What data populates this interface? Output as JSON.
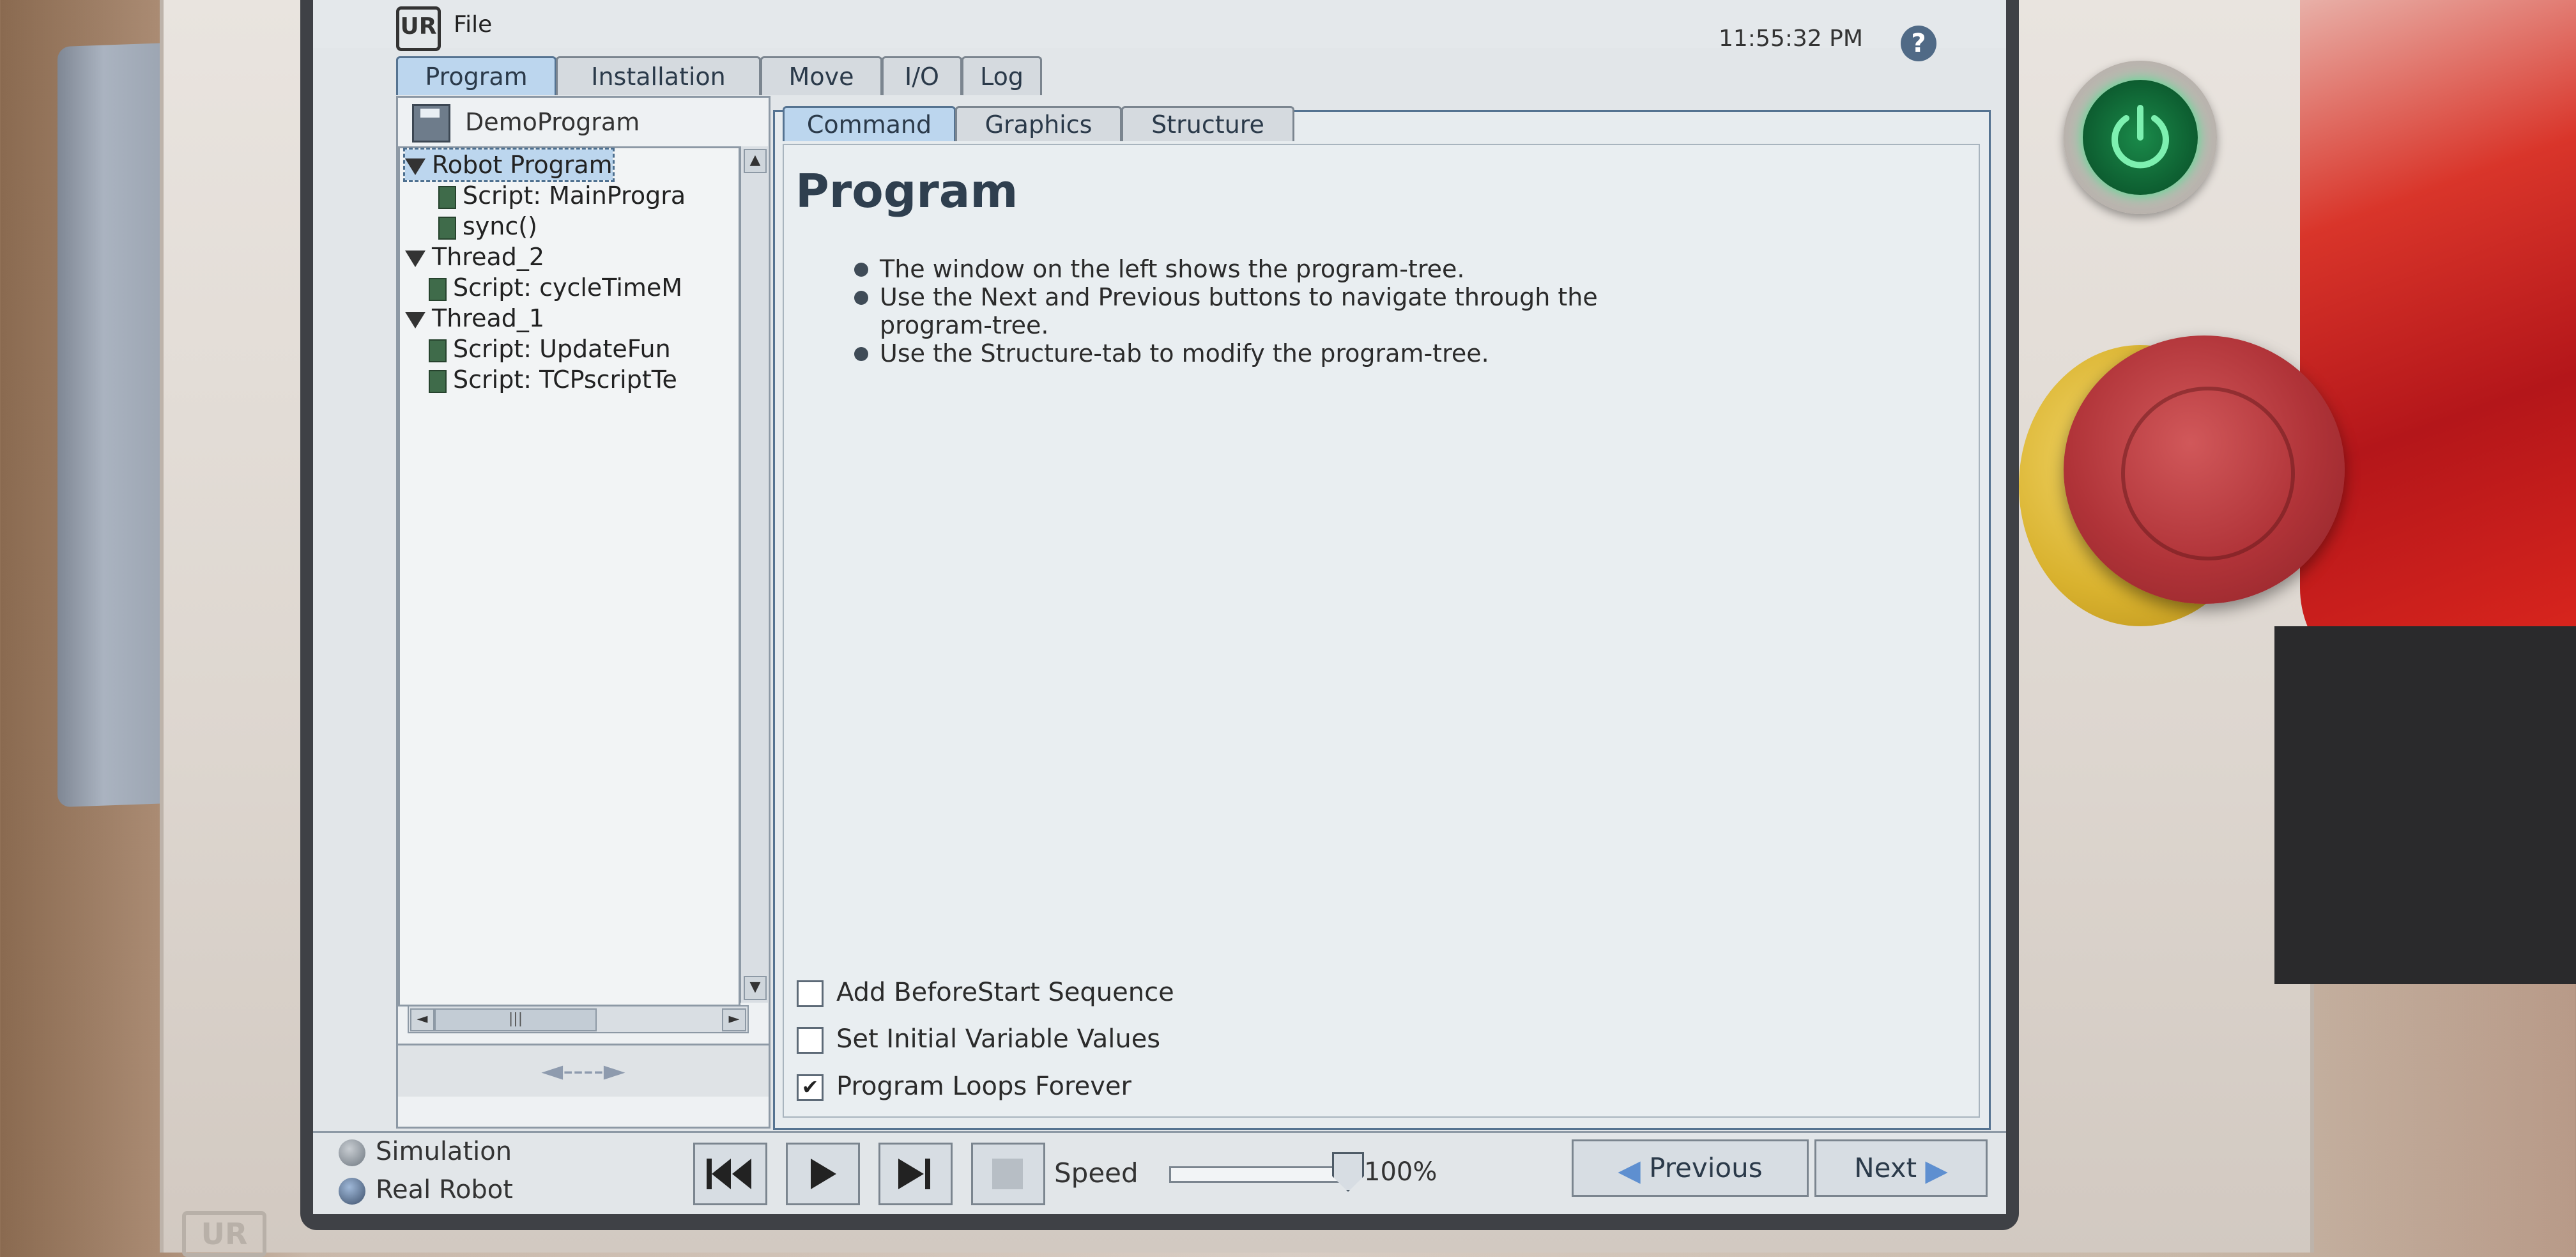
{
  "app": {
    "menu_file": "File",
    "clock": "11:55:32 PM",
    "help": "?",
    "logo_text": "UR"
  },
  "main_tabs": [
    {
      "label": "Program",
      "active": true
    },
    {
      "label": "Installation",
      "active": false
    },
    {
      "label": "Move",
      "active": false
    },
    {
      "label": "I/O",
      "active": false
    },
    {
      "label": "Log",
      "active": false
    }
  ],
  "program": {
    "name": "DemoProgram",
    "tree": [
      {
        "label": "Robot Program",
        "kind": "group",
        "selected": true
      },
      {
        "label": "Script: MainProgra",
        "kind": "script"
      },
      {
        "label": "sync()",
        "kind": "script"
      },
      {
        "label": "Thread_2",
        "kind": "group"
      },
      {
        "label": "Script: cycleTimeM",
        "kind": "script"
      },
      {
        "label": "Thread_1",
        "kind": "group"
      },
      {
        "label": "Script: UpdateFun",
        "kind": "script"
      },
      {
        "label": "Script: TCPscriptTe",
        "kind": "script"
      }
    ],
    "tree_nav_arrows": "◄----►"
  },
  "sub_tabs": [
    {
      "label": "Command",
      "active": true
    },
    {
      "label": "Graphics",
      "active": false
    },
    {
      "label": "Structure",
      "active": false
    }
  ],
  "content": {
    "title": "Program",
    "bullets": [
      "The window on the left shows the program-tree.",
      "Use the Next and Previous buttons to navigate through the program-tree.",
      "Use the Structure-tab to modify the program-tree."
    ],
    "options": [
      {
        "label": "Add BeforeStart Sequence",
        "checked": false
      },
      {
        "label": "Set Initial Variable Values",
        "checked": false
      },
      {
        "label": "Program Loops Forever",
        "checked": true
      }
    ]
  },
  "bottom": {
    "simulation_label": "Simulation",
    "real_robot_label": "Real Robot",
    "speed_label": "Speed",
    "speed_value": "100%",
    "speed_fraction": 1.0,
    "previous_label": "Previous",
    "next_label": "Next"
  },
  "colors": {
    "accent_tab": "#bcd6ee",
    "panel": "#e7ecef",
    "power_led": "#43e08a",
    "estop": "#b03338"
  },
  "icons": {
    "play": "play-icon",
    "rewind": "skip-back-icon",
    "step": "step-forward-icon",
    "stop": "stop-icon",
    "help": "help-icon",
    "power": "power-icon"
  }
}
